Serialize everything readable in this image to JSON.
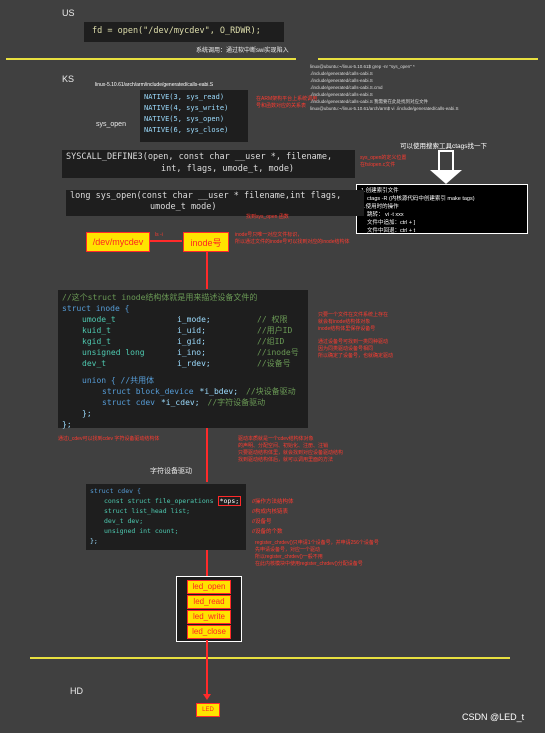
{
  "us": {
    "label": "US",
    "code": "fd = open(\"/dev/mycdev\", O_RDWR);",
    "caption": "系统调用：通过软中断swi实现陷入"
  },
  "ks": {
    "label": "KS",
    "path": "linux-5.10.61/arch/arm/include/generated/calls-eabi.S",
    "sys_open_label": "sys_open"
  },
  "natives": [
    "NATIVE(3, sys_read)",
    "NATIVE(4, sys_write)",
    "NATIVE(5, sys_open)",
    "NATIVE(6, sys_close)"
  ],
  "native_note": [
    "在ARM架构平台上系统调用",
    "号和函数对应的关系表"
  ],
  "terminal_lines": [
    "linux@ubuntu:~/linux-5.10.61$ grep -nr \"sys_open\" *",
    "./include/generated/calls-oabi.S",
    "./include/generated/calls-eabi.S",
    "./include/generated/calls-oabi.S.cmd",
    "./include/generated/calls-eabi.S",
    "./include/generated/calls-oabi.S    我需要在此处找到对应文件",
    "linux@ubuntu:~/linux-5.10.61/arch/arm$ vi ./include/generated/calls-eabi.S"
  ],
  "ctags_hint": "可以使用搜索工具ctags找一下",
  "syscall_define": [
    "SYSCALL_DEFINE3(open, const char __user *, filename,",
    "int, flags, umode_t, mode)"
  ],
  "syscall_note": [
    "sys_open的定义位置",
    "在fs/open.c文件"
  ],
  "sys_open_code": [
    "long sys_open(const char __user * filename,int flags,",
    "umode_t mode)"
  ],
  "sys_open_note": "找到sys_open 函数",
  "ctags_box": [
    "1.创建索引文件",
    "ctags -R (内核源代码中创建索引 make tags)",
    "2.使用时的操作",
    "跳转：  vi -t xxx",
    "文件中追加：ctrl + ]",
    "文件中回退：ctrl + t"
  ],
  "dev_box": "/dev/mycdev",
  "dev_arrow_label": "ls -i",
  "inode_box": "inode号",
  "inode_note": [
    "inode号只唯一对应文件标识，",
    "所以通过文件的inode号可以找到对应的inode结构体"
  ],
  "inode_struct": {
    "comment": "//这个struct inode结构体就是用来描述设备文件的",
    "decl": "struct inode {",
    "fields": [
      {
        "type": "umode_t",
        "name": "i_mode;",
        "comment": "// 权限"
      },
      {
        "type": "kuid_t",
        "name": "i_uid;",
        "comment": "//用户ID"
      },
      {
        "type": "kgid_t",
        "name": "i_gid;",
        "comment": "//组ID"
      },
      {
        "type": "unsigned long",
        "name": "i_ino;",
        "comment": "//inode号"
      },
      {
        "type": "dev_t",
        "name": "i_rdev;",
        "comment": "//设备号"
      }
    ],
    "union": "union { //共用体",
    "union_fields": [
      {
        "type": "struct block_device",
        "name": "*i_bdev;",
        "comment": "//块设备驱动"
      },
      {
        "type": "struct cdev",
        "name": "*i_cdev;",
        "comment": "//字符设备驱动"
      }
    ],
    "close_union": "};",
    "close": "};"
  },
  "inode_side_note": [
    "只要一个文件在文件系统上存在",
    "就会有inode结构体对象",
    "inode结构体里保存设备号",
    "",
    "通过设备号可找到一类同种驱动",
    "因为同类驱动设备号相同",
    "所以确定了设备号，也就确定驱动"
  ],
  "cdev_note_left": "通过i_cdev可以找到cdev 字符设备驱动结构体",
  "cdev_note_right": [
    "驱动本质就是一个cdev结构体对象",
    "的声明、分配空间、初始化、注册、注销",
    "只要驱动结构体里，就会找到对应设备驱动结构",
    "找到驱动结构体后，就可以调用里面的方法"
  ],
  "char_driver_label": "字符设备驱动",
  "cdev_struct": {
    "decl": "struct cdev {",
    "fields": [
      {
        "text": "const struct file_operations",
        "hl": "*ops;",
        "comment": "//操作方法结构体"
      },
      {
        "text": "struct list_head list;",
        "hl": "",
        "comment": "//构成内核链表"
      },
      {
        "text": "dev_t dev;",
        "hl": "",
        "comment": "//设备号"
      },
      {
        "text": "unsigned int count;",
        "hl": "",
        "comment": "//设备的个数"
      }
    ],
    "close": "};"
  },
  "cdev_side_note": [
    "register_chrdev()只申请1个设备号，并申请256个设备号",
    "先申请设备号，对应一个驱动",
    "所以register_chrdev()一般不用",
    "在此内核模块中使用register_chrdev()分配设备号"
  ],
  "fops": [
    "led_open",
    "led_read",
    "led_write",
    "led_close"
  ],
  "hd_label": "HD",
  "led_box": "LED",
  "watermark": "CSDN @LED_t"
}
